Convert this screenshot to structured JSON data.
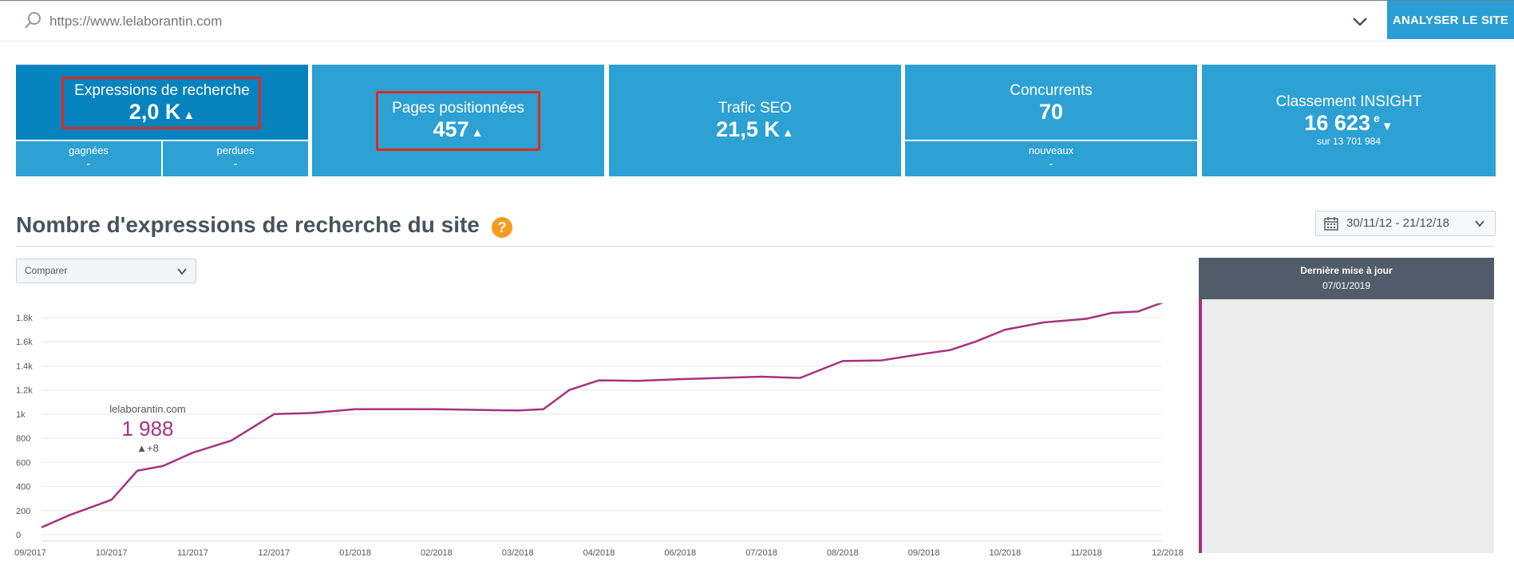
{
  "search": {
    "placeholder": "https://www.lelaborantin.com",
    "button_label": "ANALYSER LE SITE"
  },
  "kpis": {
    "expressions": {
      "label": "Expressions de recherche",
      "value": "2,0 K",
      "trend": "▲",
      "gained_label": "gagnées",
      "gained_value": "-",
      "lost_label": "perdues",
      "lost_value": "-"
    },
    "pages": {
      "label": "Pages positionnées",
      "value": "457",
      "trend": "▲"
    },
    "traffic": {
      "label": "Trafic SEO",
      "value": "21,5 K",
      "trend": "▲"
    },
    "competitors": {
      "label": "Concurrents",
      "value": "70",
      "new_label": "nouveaux",
      "new_value": "-"
    },
    "ranking": {
      "label": "Classement INSIGHT",
      "value": "16 623",
      "suffix": "e",
      "trend": "▼",
      "sub": "sur 13 701 984"
    }
  },
  "section": {
    "title": "Nombre d'expressions de recherche du site",
    "help": "?"
  },
  "date_range": "30/11/12 - 21/12/18",
  "compare_label": "Comparer",
  "panel": {
    "title": "Dernière mise à jour",
    "date": "07/01/2019",
    "site": "lelaborantin.com",
    "value": "1 988",
    "delta": "▲+8"
  },
  "colors": {
    "kpi_blue": "#2da0d4",
    "kpi_dark": "#0682bf",
    "button_blue": "#2a9dd4",
    "series": "#a8317f",
    "highlight_red": "#e0291d",
    "help_orange": "#f59b24"
  },
  "chart_data": {
    "type": "line",
    "xlabel": "",
    "ylabel": "",
    "ylim": [
      0,
      1800
    ],
    "yticks": [
      "0",
      "200",
      "400",
      "600",
      "800",
      "1k",
      "1.2k",
      "1.4k",
      "1.6k",
      "1.8k"
    ],
    "xticks": [
      "09/2017",
      "10/2017",
      "11/2017",
      "12/2017",
      "01/2018",
      "02/2018",
      "03/2018",
      "04/2018",
      "06/2018",
      "07/2018",
      "08/2018",
      "09/2018",
      "10/2018",
      "11/2018",
      "12/2018"
    ],
    "grid": true,
    "series": [
      {
        "x": [
          "09/2017",
          "09/2017",
          "10/2017",
          "10/2017",
          "10/2017",
          "11/2017",
          "11/2017",
          "12/2017",
          "12/2017",
          "01/2018",
          "02/2018",
          "03/2018",
          "03/2018",
          "03/2018",
          "04/2018",
          "04/2018",
          "06/2018",
          "07/2018",
          "07/2018",
          "08/2018",
          "08/2018",
          "09/2018",
          "09/2018",
          "09/2018",
          "10/2018",
          "10/2018",
          "11/2018",
          "11/2018",
          "11/2018",
          "12/2018",
          "12/2018",
          "12/2018"
        ],
        "values": [
          60,
          160,
          290,
          530,
          570,
          680,
          780,
          1000,
          1010,
          1040,
          1040,
          1030,
          1040,
          1200,
          1280,
          1275,
          1290,
          1310,
          1300,
          1440,
          1445,
          1500,
          1530,
          1600,
          1700,
          1760,
          1790,
          1840,
          1850,
          1940,
          1930,
          1960
        ]
      }
    ]
  }
}
